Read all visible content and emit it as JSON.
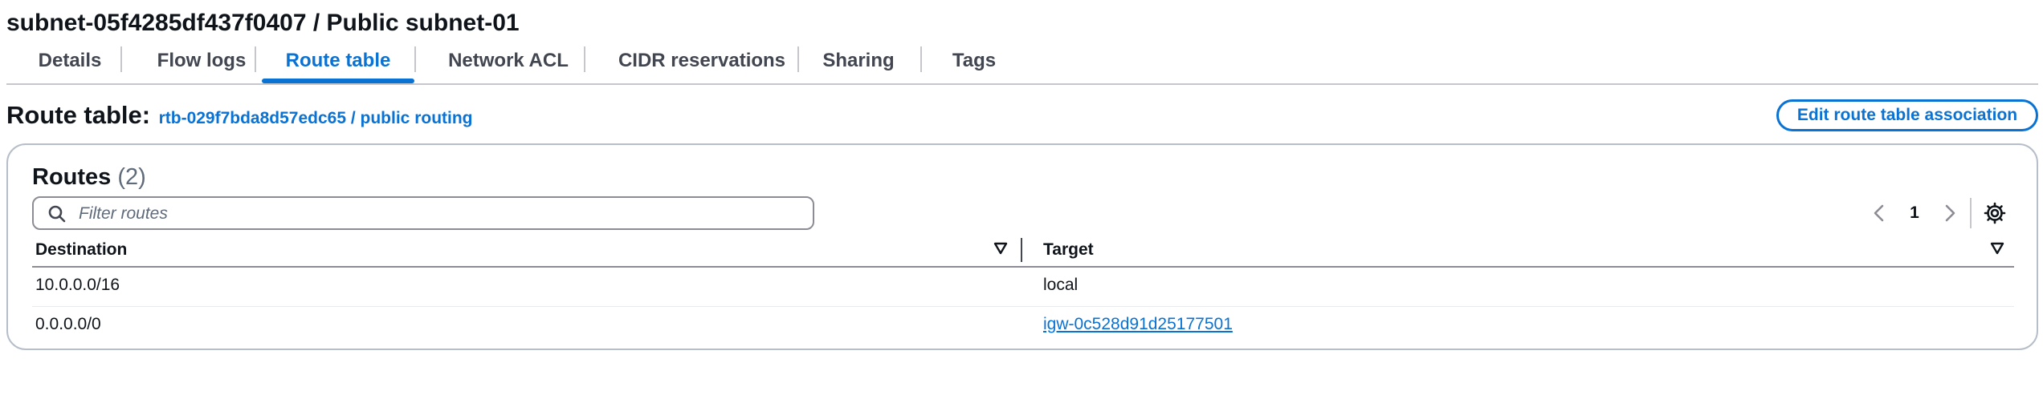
{
  "page": {
    "title": "subnet-05f4285df437f0407 / Public subnet-01"
  },
  "tabs": [
    {
      "label": "Details"
    },
    {
      "label": "Flow logs"
    },
    {
      "label": "Route table",
      "active": true
    },
    {
      "label": "Network ACL"
    },
    {
      "label": "CIDR reservations"
    },
    {
      "label": "Sharing"
    },
    {
      "label": "Tags"
    }
  ],
  "route_table": {
    "label": "Route table:",
    "link": "rtb-029f7bda8d57edc65 / public routing",
    "edit_button": "Edit route table association"
  },
  "routes": {
    "title": "Routes",
    "count": "(2)",
    "filter_placeholder": "Filter routes",
    "filter_value": "",
    "page": "1",
    "columns": [
      "Destination",
      "Target"
    ],
    "rows": [
      {
        "destination": "10.0.0.0/16",
        "target": "local",
        "target_is_link": false
      },
      {
        "destination": "0.0.0.0/0",
        "target": "igw-0c528d91d25177501",
        "target_is_link": true
      }
    ]
  },
  "colors": {
    "accent": "#0972d3",
    "text": "#0f141a",
    "muted": "#5f6b7a",
    "border": "#b6bec9"
  },
  "icons": [
    "search-icon",
    "chevron-left-icon",
    "chevron-right-icon",
    "gear-icon",
    "sort-caret-icon"
  ]
}
